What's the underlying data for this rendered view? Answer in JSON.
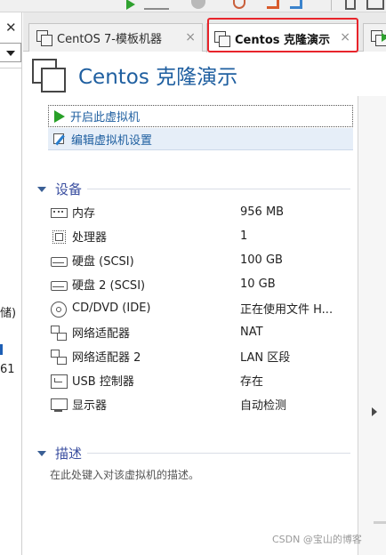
{
  "left_panel": {
    "close_glyph": "✕",
    "partial_text_1": "储)",
    "partial_text_2": "61"
  },
  "tabs": [
    {
      "label": "CentOS 7-模板机器",
      "close": "×",
      "active": false
    },
    {
      "label": "Centos 克隆演示",
      "close": "×",
      "active": true
    }
  ],
  "vm": {
    "title": "Centos 克隆演示"
  },
  "actions": [
    {
      "label": "开启此虚拟机",
      "icon": "play-icon"
    },
    {
      "label": "编辑虚拟机设置",
      "icon": "edit-settings-icon"
    }
  ],
  "devices_section": {
    "title": "设备",
    "items": [
      {
        "name": "内存",
        "value": "956 MB",
        "icon": "memory-icon"
      },
      {
        "name": "处理器",
        "value": "1",
        "icon": "processor-icon"
      },
      {
        "name": "硬盘 (SCSI)",
        "value": "100 GB",
        "icon": "hard-disk-icon"
      },
      {
        "name": "硬盘 2 (SCSI)",
        "value": "10 GB",
        "icon": "hard-disk-icon"
      },
      {
        "name": "CD/DVD (IDE)",
        "value": "正在使用文件 H...",
        "icon": "cd-dvd-icon"
      },
      {
        "name": "网络适配器",
        "value": "NAT",
        "icon": "network-adapter-icon"
      },
      {
        "name": "网络适配器 2",
        "value": "LAN 区段",
        "icon": "network-adapter-icon"
      },
      {
        "name": "USB 控制器",
        "value": "存在",
        "icon": "usb-icon"
      },
      {
        "name": "显示器",
        "value": "自动检测",
        "icon": "display-icon"
      }
    ]
  },
  "description_section": {
    "title": "描述",
    "placeholder": "在此处键入对该虚拟机的描述。"
  },
  "watermark": "CSDN @宝山的博客",
  "colors": {
    "title_blue": "#1f5fa0",
    "section_blue": "#3b4fa0",
    "highlight_red": "#e8242b",
    "play_green": "#28a028"
  }
}
